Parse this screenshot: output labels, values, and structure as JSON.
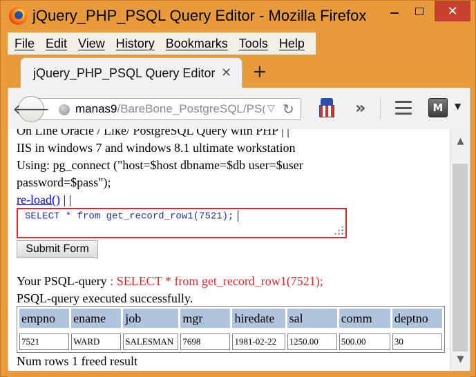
{
  "window": {
    "title": "jQuery_PHP_PSQL Query Editor - Mozilla Firefox",
    "controls": {
      "minimize": "",
      "maximize": "",
      "close": "✕"
    }
  },
  "menubar": {
    "items": [
      {
        "label": "File"
      },
      {
        "label": "Edit"
      },
      {
        "label": "View"
      },
      {
        "label": "History"
      },
      {
        "label": "Bookmarks"
      },
      {
        "label": "Tools"
      },
      {
        "label": "Help"
      }
    ]
  },
  "tabs": [
    {
      "label": "jQuery_PHP_PSQL Query Editor",
      "close": "✕"
    }
  ],
  "new_tab": "+",
  "navbar": {
    "back": "🡐",
    "url_host": "manas9",
    "url_path": "/BareBone_PostgreSQL/PS(",
    "url_dropdown": "▽",
    "url_reload": "↻",
    "overflow": "»",
    "mcafee_label": "M",
    "mcafee_dropdown": "▼"
  },
  "content": {
    "header_lines": [
      "On Line Oracle / Like/ PostgreSQL Query with PHP | |",
      "IIS in windows 7 and windows 8.1 ultimate workstation",
      "Using: pg_connect (\"host=$host dbname=$db user=$user",
      "password=$pass\");"
    ],
    "reload_link": "re-load()",
    "reload_suffix": "| |",
    "query_text": "SELECT * from get_record_row1(7521);",
    "submit_label": "Submit Form",
    "your_query_label": "Your PSQL-query",
    "your_query_value": ": SELECT * from get_record_row1(7521);",
    "executed_msg": "PSQL-query executed successfully.",
    "table": {
      "headers": [
        "empno",
        "ename",
        "job",
        "mgr",
        "hiredate",
        "sal",
        "comm",
        "deptno"
      ],
      "rows": [
        [
          "7521",
          "WARD",
          "SALESMAN",
          "7698",
          "1981-02-22",
          "1250.00",
          "500.00",
          "30"
        ]
      ]
    },
    "footer": "Num rows 1 freed result"
  },
  "scrollbar": {
    "up": "▲",
    "down": "▼"
  }
}
